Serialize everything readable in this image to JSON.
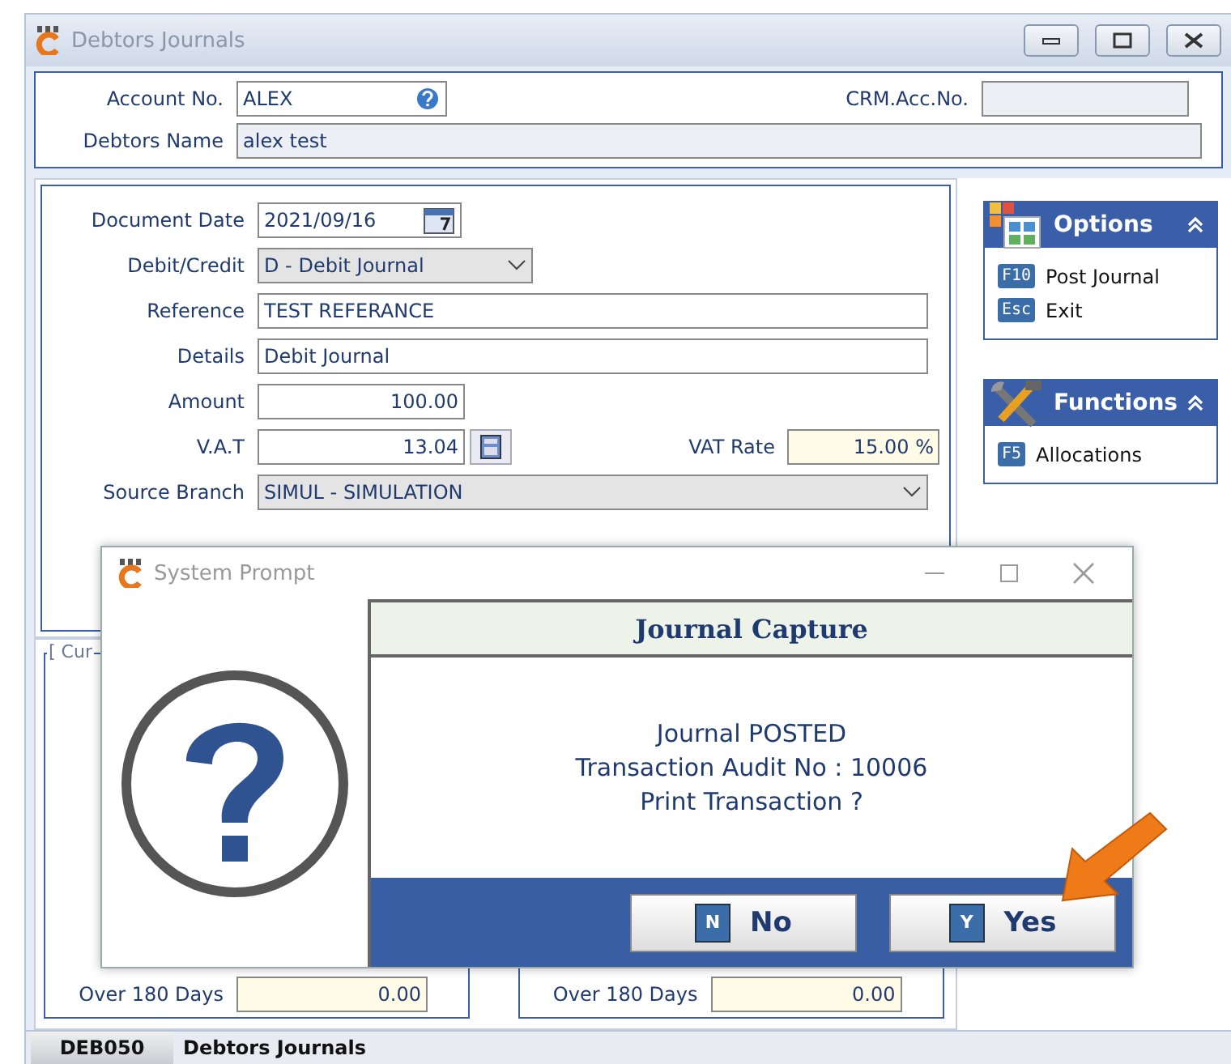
{
  "window": {
    "title": "Debtors Journals"
  },
  "header": {
    "account_no": {
      "label": "Account No.",
      "value": "ALEX"
    },
    "crm_acc_no": {
      "label": "CRM.Acc.No."
    },
    "debtors_name": {
      "label": "Debtors Name",
      "value": "alex test"
    }
  },
  "form": {
    "document_date": {
      "label": "Document Date",
      "value": "2021/09/16"
    },
    "debit_credit": {
      "label": "Debit/Credit",
      "value": "D - Debit Journal"
    },
    "reference": {
      "label": "Reference",
      "value": "TEST REFERANCE"
    },
    "details": {
      "label": "Details",
      "value": "Debit Journal"
    },
    "amount": {
      "label": "Amount",
      "value": "100.00"
    },
    "vat": {
      "label": "V.A.T",
      "value": "13.04"
    },
    "vat_rate": {
      "label": "VAT Rate",
      "value": "15.00 %"
    },
    "source_branch": {
      "label": "Source Branch",
      "value": "SIMUL - SIMULATION"
    }
  },
  "panels": [
    {
      "kind": "options",
      "title": "Options",
      "items": [
        {
          "key": "F10",
          "label": "Post Journal"
        },
        {
          "key": "Esc",
          "label": "Exit"
        }
      ]
    },
    {
      "kind": "functions",
      "title": "Functions",
      "items": [
        {
          "key": "F5",
          "label": "Allocations"
        }
      ]
    }
  ],
  "groups": [
    {
      "label": "[ Cur",
      "rows": [
        {
          "label": "Over 180 Days",
          "value": "0.00"
        }
      ]
    },
    {
      "rows": [
        {
          "label": "Over 180 Days",
          "value": "0.00"
        }
      ]
    }
  ],
  "dialog": {
    "title": "System Prompt",
    "heading": "Journal Capture",
    "message": [
      "Journal POSTED",
      "Transaction Audit No : 10006",
      "Print Transaction ?"
    ],
    "buttons": [
      {
        "key": "N",
        "label": "No"
      },
      {
        "key": "Y",
        "label": "Yes"
      }
    ]
  },
  "status_bar": {
    "code": "DEB050",
    "title": "Debtors Journals"
  }
}
